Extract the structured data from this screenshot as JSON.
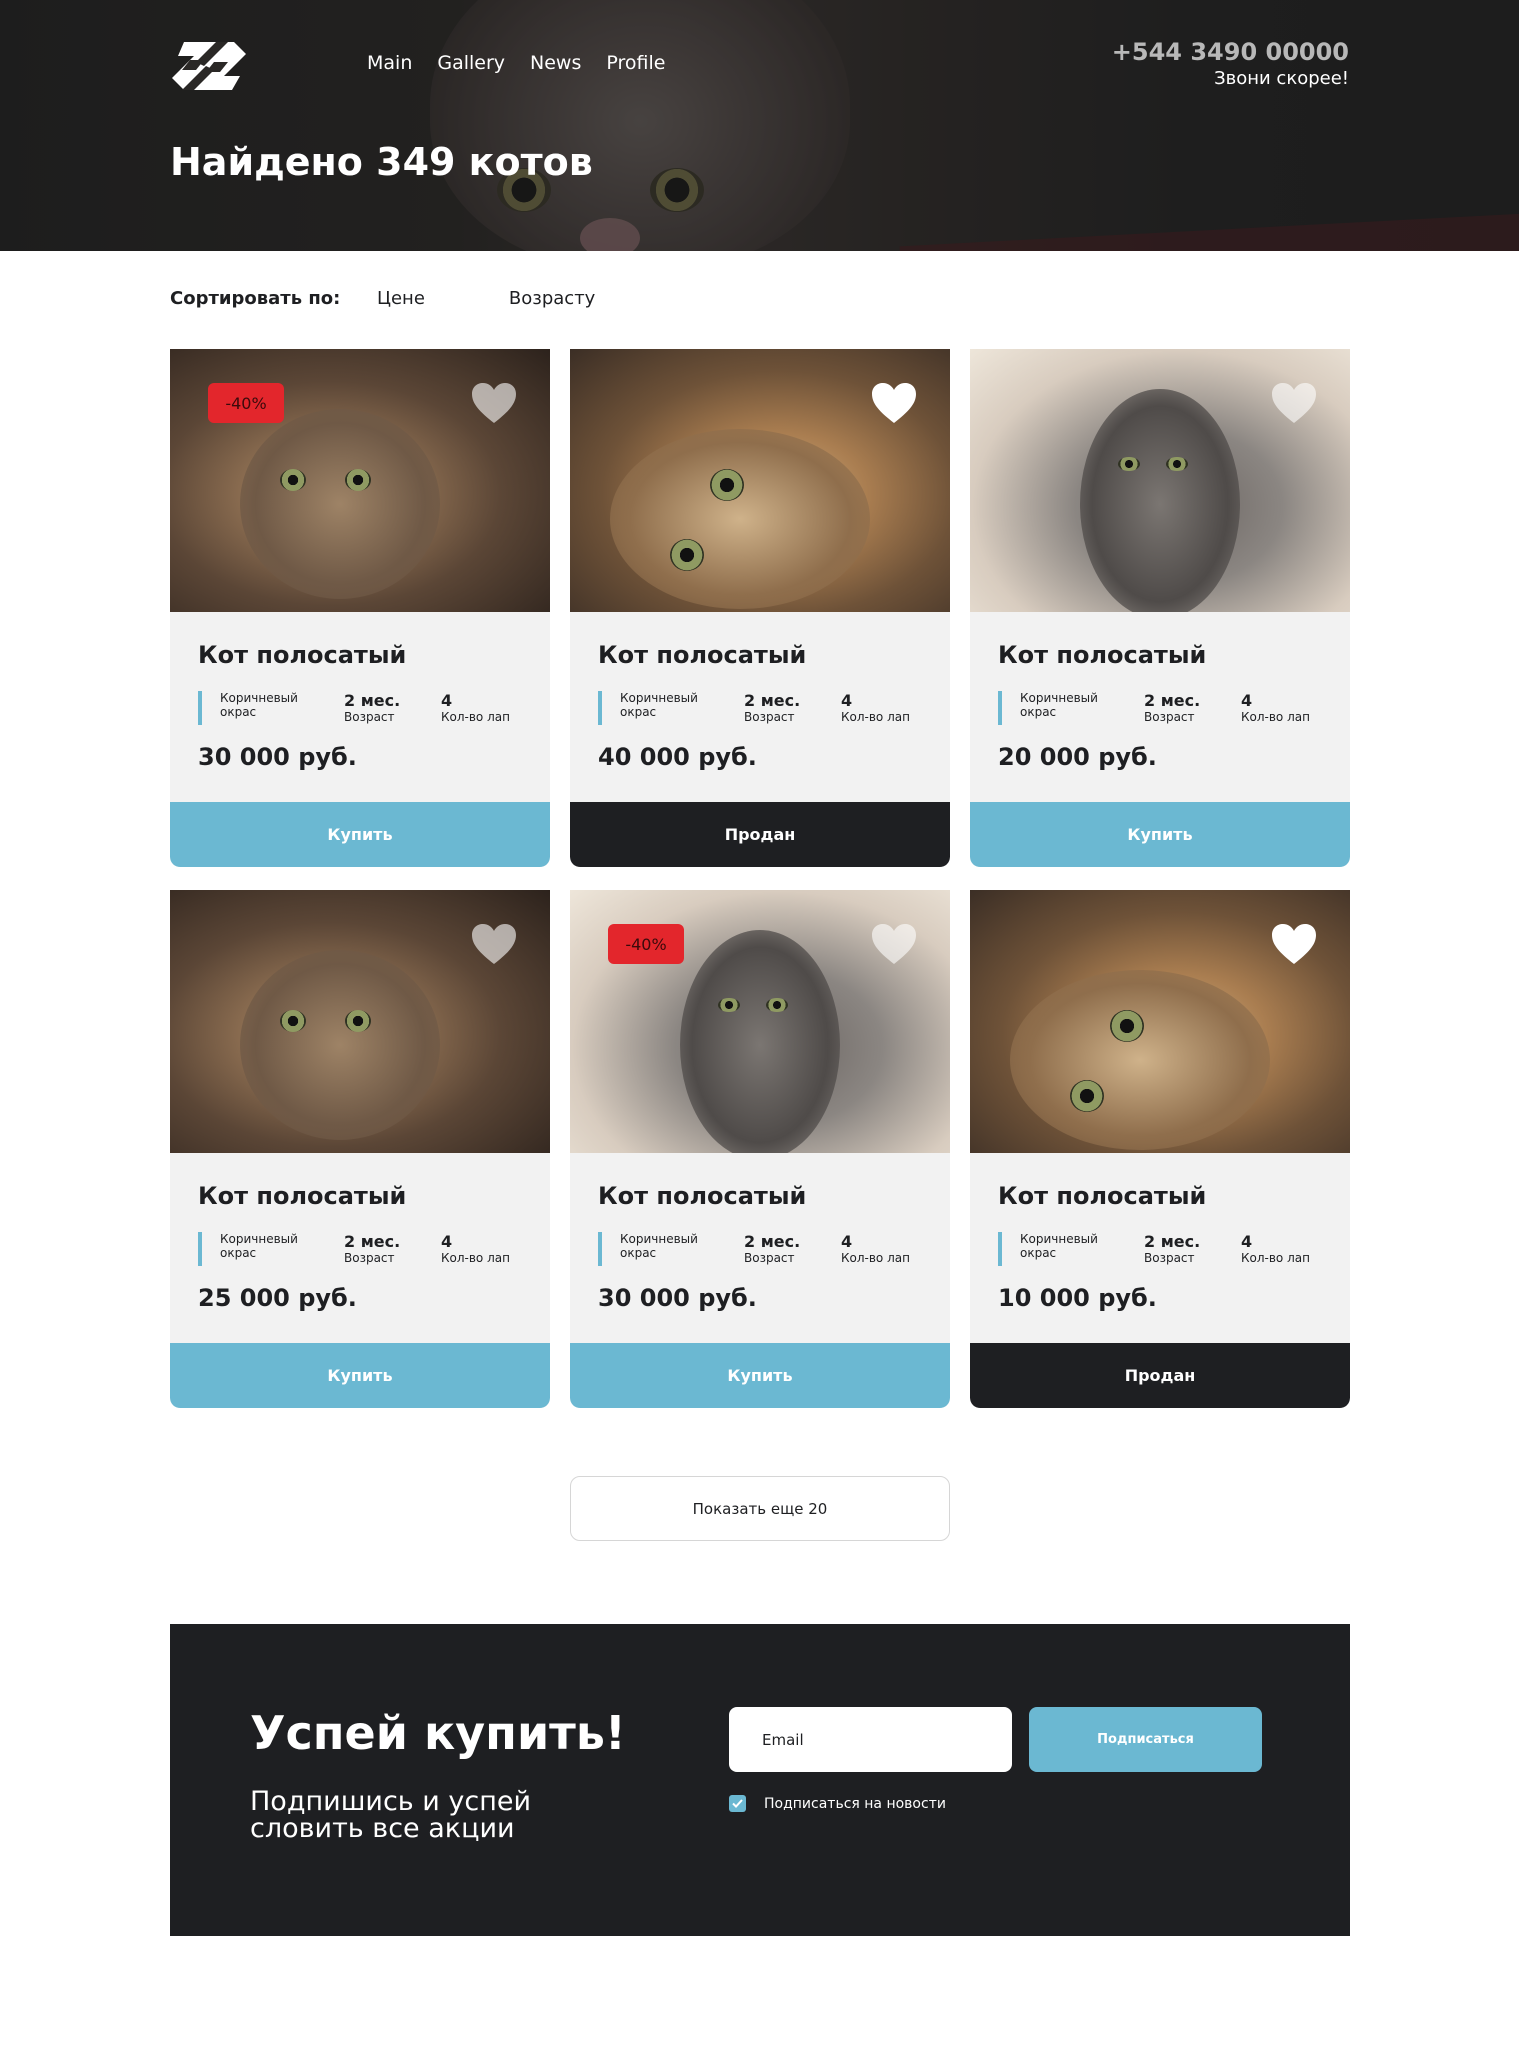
{
  "header": {
    "nav": [
      "Main",
      "Gallery",
      "News",
      "Profile"
    ],
    "phone": "+544 3490 00000",
    "phone_caption": "Звони скорее!",
    "title": "Найдено 349 котов"
  },
  "sort": {
    "label": "Сортировать по:",
    "options": [
      "Цене",
      "Возрасту"
    ]
  },
  "cards": [
    {
      "name": "Кот полосатый",
      "color": "Коричневый",
      "color_label": "окрас",
      "age": "2 мес.",
      "age_label": "Возраст",
      "paws": "4",
      "paws_label": "Кол-во лап",
      "price": "30 000 руб.",
      "badge": "-40%",
      "liked": false,
      "button": "Купить",
      "button_state": "buy"
    },
    {
      "name": "Кот полосатый",
      "color": "Коричневый",
      "color_label": "окрас",
      "age": "2 мес.",
      "age_label": "Возраст",
      "paws": "4",
      "paws_label": "Кол-во лап",
      "price": "40 000 руб.",
      "badge": "",
      "liked": true,
      "button": "Продан",
      "button_state": "sold"
    },
    {
      "name": "Кот полосатый",
      "color": "Коричневый",
      "color_label": "окрас",
      "age": "2 мес.",
      "age_label": "Возраст",
      "paws": "4",
      "paws_label": "Кол-во лап",
      "price": "20 000 руб.",
      "badge": "",
      "liked": false,
      "button": "Купить",
      "button_state": "buy"
    },
    {
      "name": "Кот полосатый",
      "color": "Коричневый",
      "color_label": "окрас",
      "age": "2 мес.",
      "age_label": "Возраст",
      "paws": "4",
      "paws_label": "Кол-во лап",
      "price": "25 000 руб.",
      "badge": "",
      "liked": false,
      "button": "Купить",
      "button_state": "buy"
    },
    {
      "name": "Кот полосатый",
      "color": "Коричневый",
      "color_label": "окрас",
      "age": "2 мес.",
      "age_label": "Возраст",
      "paws": "4",
      "paws_label": "Кол-во лап",
      "price": "30 000 руб.",
      "badge": "-40%",
      "liked": false,
      "button": "Купить",
      "button_state": "buy"
    },
    {
      "name": "Кот полосатый",
      "color": "Коричневый",
      "color_label": "окрас",
      "age": "2 мес.",
      "age_label": "Возраст",
      "paws": "4",
      "paws_label": "Кол-во лап",
      "price": "10 000 руб.",
      "badge": "",
      "liked": true,
      "button": "Продан",
      "button_state": "sold"
    }
  ],
  "more_button": "Показать еще 20",
  "subscribe": {
    "title": "Успей купить!",
    "subtitle": "Подпишись и успей словить все акции",
    "email_placeholder": "Email",
    "button": "Подписаться",
    "checkbox_label": "Подписаться на новости",
    "checkbox_checked": true
  },
  "colors": {
    "accent": "#6bb8d2",
    "dark": "#1e1f22",
    "badge": "#e3262c",
    "card_bg": "#f2f2f2"
  },
  "icons": [
    "logo-icon",
    "heart-icon",
    "check-icon"
  ]
}
